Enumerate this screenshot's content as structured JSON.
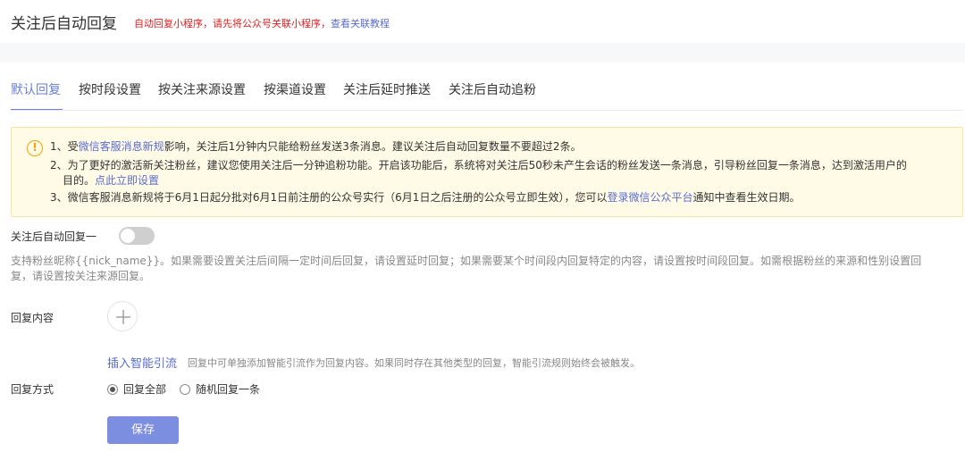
{
  "header": {
    "title": "关注后自动回复",
    "note": "自动回复小程序，请先将公众号关联小程序，",
    "note_link": "查看关联教程"
  },
  "tabs": [
    {
      "label": "默认回复",
      "active": true
    },
    {
      "label": "按时段设置",
      "active": false
    },
    {
      "label": "按关注来源设置",
      "active": false
    },
    {
      "label": "按渠道设置",
      "active": false
    },
    {
      "label": "关注后延时推送",
      "active": false
    },
    {
      "label": "关注后自动追粉",
      "active": false
    }
  ],
  "notice": {
    "icon": "warning-icon",
    "line1_pre": "1、受",
    "line1_link": "微信客服消息新规",
    "line1_post": "影响，关注后1分钟内只能给粉丝发送3条消息。建议关注后自动回复数量不要超过2条。",
    "line2": "2、为了更好的激活新关注粉丝，建议您使用关注后一分钟追粉功能。开启该功能后，系统将对关注后50秒未产生会话的粉丝发送一条消息，引导粉丝回复一条消息，达到激活用户的",
    "line2b_pre": "目的。",
    "line2b_link": "点此立即设置",
    "line3_pre": "3、微信客服消息新规将于6月1日起分批对6月1日前注册的公众号实行（6月1日之后注册的公众号立即生效），您可以",
    "line3_link": "登录微信公众平台",
    "line3_post": "通知中查看生效日期。",
    "accent_color": "#f0a400"
  },
  "toggle": {
    "label": "关注后自动回复一",
    "on": false
  },
  "description": {
    "line1": "支持粉丝昵称{{nick_name}}。如果需要设置关注后间隔一定时间后回复，请设置延时回复；如果需要某个时间段内回复特定的内容，请设置按时间段回复。如需根据粉丝的来源和性别设置回",
    "line2": "复，请设置按关注来源回复。"
  },
  "reply_content": {
    "label": "回复内容",
    "add_icon": "plus-icon"
  },
  "smart_guide": {
    "link": "插入智能引流",
    "hint": "回复中可单独添加智能引流作为回复内容。如果同时存在其他类型的回复，智能引流规则始终会被触发。"
  },
  "reply_mode": {
    "label": "回复方式",
    "options": [
      {
        "label": "回复全部",
        "checked": true
      },
      {
        "label": "随机回复一条",
        "checked": false
      }
    ]
  },
  "save_label": "保存",
  "colors": {
    "brand": "#6a7fd9",
    "save_button": "#7b8ee0",
    "link": "#5b6dd1",
    "alert_red": "#e02020",
    "notice_bg": "#fffbe6"
  }
}
